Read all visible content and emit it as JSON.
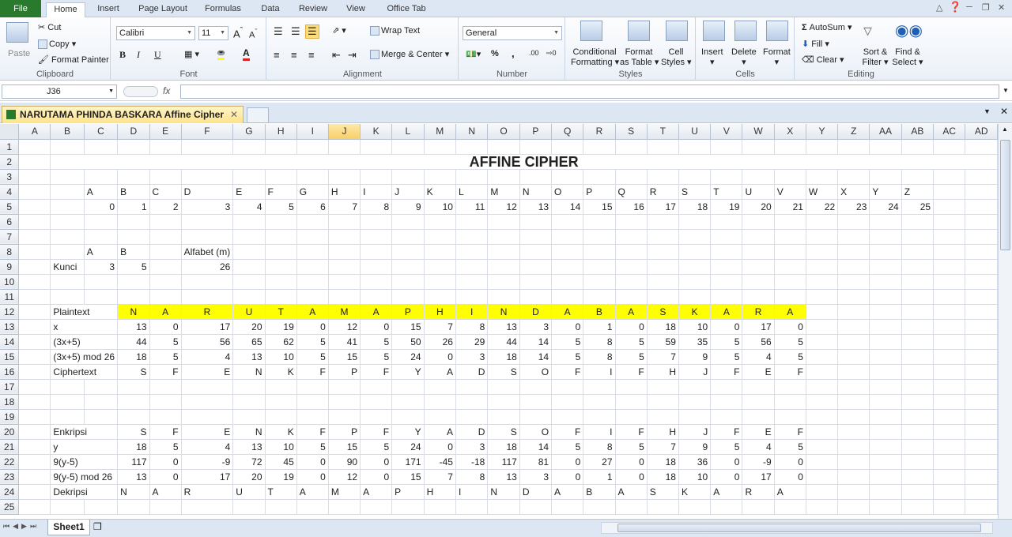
{
  "ribbon_tabs": [
    "File",
    "Home",
    "Insert",
    "Page Layout",
    "Formulas",
    "Data",
    "Review",
    "View",
    "Office Tab"
  ],
  "clipboard": {
    "paste": "Paste",
    "cut": "Cut",
    "copy": "Copy",
    "format_painter": "Format Painter",
    "label": "Clipboard"
  },
  "font": {
    "name": "Calibri",
    "size": "11",
    "label": "Font",
    "bold": "B",
    "italic": "I",
    "underline": "U"
  },
  "alignment": {
    "wrap": "Wrap Text",
    "merge": "Merge & Center",
    "label": "Alignment"
  },
  "number": {
    "format": "General",
    "percent": "%",
    "comma": ",",
    "inc": ".00",
    "label": "Number"
  },
  "styles": {
    "conditional": "Conditional",
    "formatting": "Formatting",
    "format_as": "Format",
    "table": "as Table",
    "cell": "Cell",
    "cell_styles": "Styles",
    "label": "Styles"
  },
  "cells": {
    "insert": "Insert",
    "delete": "Delete",
    "format": "Format",
    "label": "Cells"
  },
  "editing": {
    "autosum": "AutoSum",
    "fill": "Fill",
    "clear": "Clear",
    "sort": "Sort &",
    "filter": "Filter",
    "find": "Find &",
    "select": "Select",
    "label": "Editing"
  },
  "name_box": "J36",
  "fx": "fx",
  "doc_tab": "NARUTAMA PHINDA BASKARA Affine Cipher",
  "sheet_tab": "Sheet1",
  "columns": [
    "A",
    "B",
    "C",
    "D",
    "E",
    "F",
    "G",
    "H",
    "I",
    "J",
    "K",
    "L",
    "M",
    "N",
    "O",
    "P",
    "Q",
    "R",
    "S",
    "T",
    "U",
    "V",
    "W",
    "X",
    "Y",
    "Z",
    "AA",
    "AB",
    "AC",
    "AD"
  ],
  "sheet": {
    "title": "AFFINE CIPHER",
    "alpha_letters": [
      "A",
      "B",
      "C",
      "D",
      "E",
      "F",
      "G",
      "H",
      "I",
      "J",
      "K",
      "L",
      "M",
      "N",
      "O",
      "P",
      "Q",
      "R",
      "S",
      "T",
      "U",
      "V",
      "W",
      "X",
      "Y",
      "Z"
    ],
    "alpha_nums": [
      "0",
      "1",
      "2",
      "3",
      "4",
      "5",
      "6",
      "7",
      "8",
      "9",
      "10",
      "11",
      "12",
      "13",
      "14",
      "15",
      "16",
      "17",
      "18",
      "19",
      "20",
      "21",
      "22",
      "23",
      "24",
      "25"
    ],
    "key_header": {
      "a": "A",
      "b": "B",
      "m": "Alfabet (m)"
    },
    "key_row": {
      "label": "Kunci",
      "a": "3",
      "b": "5",
      "m": "26"
    },
    "rows": [
      {
        "r": "12",
        "label": "Plaintext",
        "kind": "yellow",
        "values": [
          "N",
          "A",
          "R",
          "U",
          "T",
          "A",
          "M",
          "A",
          "P",
          "H",
          "I",
          "N",
          "D",
          "A",
          "B",
          "A",
          "S",
          "K",
          "A",
          "R",
          "A"
        ]
      },
      {
        "r": "13",
        "label": "x",
        "kind": "num",
        "values": [
          "13",
          "0",
          "17",
          "20",
          "19",
          "0",
          "12",
          "0",
          "15",
          "7",
          "8",
          "13",
          "3",
          "0",
          "1",
          "0",
          "18",
          "10",
          "0",
          "17",
          "0"
        ]
      },
      {
        "r": "14",
        "label": "(3x+5)",
        "kind": "num",
        "values": [
          "44",
          "5",
          "56",
          "65",
          "62",
          "5",
          "41",
          "5",
          "50",
          "26",
          "29",
          "44",
          "14",
          "5",
          "8",
          "5",
          "59",
          "35",
          "5",
          "56",
          "5"
        ]
      },
      {
        "r": "15",
        "label": "(3x+5) mod 26",
        "kind": "num",
        "values": [
          "18",
          "5",
          "4",
          "13",
          "10",
          "5",
          "15",
          "5",
          "24",
          "0",
          "3",
          "18",
          "14",
          "5",
          "8",
          "5",
          "7",
          "9",
          "5",
          "4",
          "5"
        ]
      },
      {
        "r": "16",
        "label": "Ciphertext",
        "kind": "num",
        "values": [
          "S",
          "F",
          "E",
          "N",
          "K",
          "F",
          "P",
          "F",
          "Y",
          "A",
          "D",
          "S",
          "O",
          "F",
          "I",
          "F",
          "H",
          "J",
          "F",
          "E",
          "F"
        ]
      },
      {
        "r": "20",
        "label": "Enkripsi",
        "kind": "num",
        "values": [
          "S",
          "F",
          "E",
          "N",
          "K",
          "F",
          "P",
          "F",
          "Y",
          "A",
          "D",
          "S",
          "O",
          "F",
          "I",
          "F",
          "H",
          "J",
          "F",
          "E",
          "F"
        ]
      },
      {
        "r": "21",
        "label": "y",
        "kind": "num",
        "values": [
          "18",
          "5",
          "4",
          "13",
          "10",
          "5",
          "15",
          "5",
          "24",
          "0",
          "3",
          "18",
          "14",
          "5",
          "8",
          "5",
          "7",
          "9",
          "5",
          "4",
          "5"
        ]
      },
      {
        "r": "22",
        "label": "9(y-5)",
        "kind": "num",
        "values": [
          "117",
          "0",
          "-9",
          "72",
          "45",
          "0",
          "90",
          "0",
          "171",
          "-45",
          "-18",
          "117",
          "81",
          "0",
          "27",
          "0",
          "18",
          "36",
          "0",
          "-9",
          "0"
        ]
      },
      {
        "r": "23",
        "label": "9(y-5) mod 26",
        "kind": "num",
        "values": [
          "13",
          "0",
          "17",
          "20",
          "19",
          "0",
          "12",
          "0",
          "15",
          "7",
          "8",
          "13",
          "3",
          "0",
          "1",
          "0",
          "18",
          "10",
          "0",
          "17",
          "0"
        ]
      },
      {
        "r": "24",
        "label": "Dekripsi",
        "kind": "left",
        "values": [
          "N",
          "A",
          "R",
          "U",
          "T",
          "A",
          "M",
          "A",
          "P",
          "H",
          "I",
          "N",
          "D",
          "A",
          "B",
          "A",
          "S",
          "K",
          "A",
          "R",
          "A"
        ]
      }
    ]
  }
}
